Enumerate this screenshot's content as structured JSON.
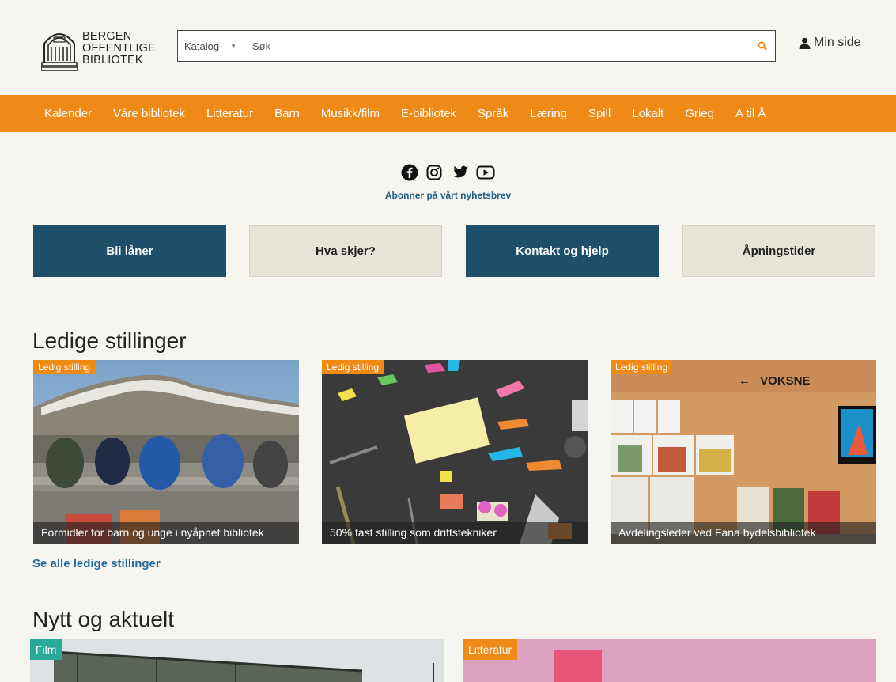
{
  "logo": {
    "line1": "BERGEN",
    "line2": "OFFENTLIGE",
    "line3": "BIBLIOTEK"
  },
  "search": {
    "scope": "Katalog",
    "placeholder": "Søk",
    "icon": "search-icon"
  },
  "account": {
    "label": "Min side",
    "icon": "user-icon"
  },
  "nav": [
    "Kalender",
    "Våre bibliotek",
    "Litteratur",
    "Barn",
    "Musikk/film",
    "E-bibliotek",
    "Språk",
    "Læring",
    "Spill",
    "Lokalt",
    "Grieg",
    "A til Å"
  ],
  "social": [
    "facebook-icon",
    "instagram-icon",
    "twitter-icon",
    "youtube-icon"
  ],
  "newsletter": "Abonner på vårt nyhetsbrev",
  "quick_links": [
    "Bli låner",
    "Hva skjer?",
    "Kontakt og hjelp",
    "Åpningstider"
  ],
  "jobs": {
    "heading": "Ledige stillinger",
    "badge": "Ledig stilling",
    "cards": [
      {
        "caption": "Formidler for barn og unge i nyåpnet bibliotek"
      },
      {
        "caption": "50% fast stilling som driftstekniker"
      },
      {
        "caption": "Avdelingsleder ved Fana bydelsbibliotek",
        "sign": "VOKSNE"
      }
    ],
    "see_all": "Se alle ledige stillinger"
  },
  "news": {
    "heading": "Nytt og aktuelt",
    "cards": [
      {
        "badge": "Film"
      },
      {
        "badge": "Litteratur"
      }
    ]
  },
  "colors": {
    "orange": "#ef8a17",
    "teal": "#1d5068",
    "link": "#1f6a9a",
    "background": "#f7f5ef"
  }
}
